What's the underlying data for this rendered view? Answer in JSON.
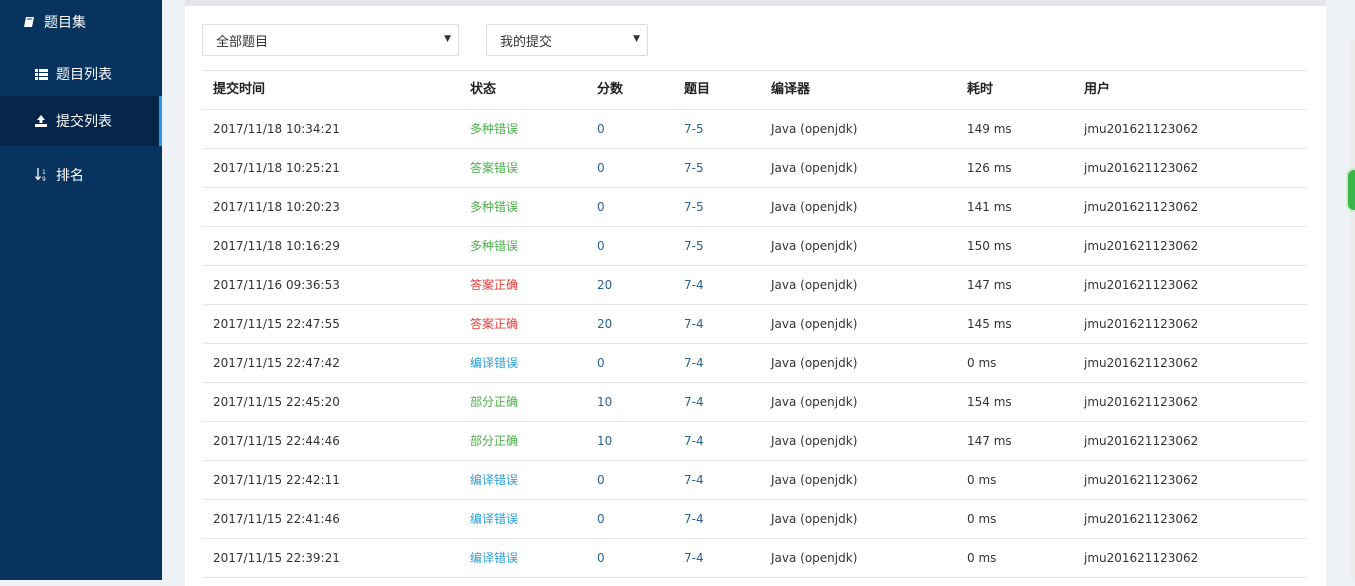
{
  "sidebar": {
    "items": [
      {
        "label": "题目集",
        "icon": "book-icon"
      },
      {
        "label": "题目列表",
        "icon": "list-icon"
      },
      {
        "label": "提交列表",
        "icon": "upload-icon",
        "active": true
      },
      {
        "label": "排名",
        "icon": "sort-icon"
      }
    ]
  },
  "filters": {
    "problem_filter": "全部题目",
    "submission_filter": "我的提交"
  },
  "table": {
    "headers": [
      "提交时间",
      "状态",
      "分数",
      "题目",
      "编译器",
      "耗时",
      "用户"
    ],
    "rows": [
      [
        "2017/11/18 10:34:21",
        "多种错误",
        "0",
        "7-5",
        "Java (openjdk)",
        "149 ms",
        "jmu201621123062"
      ],
      [
        "2017/11/18 10:25:21",
        "答案错误",
        "0",
        "7-5",
        "Java (openjdk)",
        "126 ms",
        "jmu201621123062"
      ],
      [
        "2017/11/18 10:20:23",
        "多种错误",
        "0",
        "7-5",
        "Java (openjdk)",
        "141 ms",
        "jmu201621123062"
      ],
      [
        "2017/11/18 10:16:29",
        "多种错误",
        "0",
        "7-5",
        "Java (openjdk)",
        "150 ms",
        "jmu201621123062"
      ],
      [
        "2017/11/16 09:36:53",
        "答案正确",
        "20",
        "7-4",
        "Java (openjdk)",
        "147 ms",
        "jmu201621123062"
      ],
      [
        "2017/11/15 22:47:55",
        "答案正确",
        "20",
        "7-4",
        "Java (openjdk)",
        "145 ms",
        "jmu201621123062"
      ],
      [
        "2017/11/15 22:47:42",
        "编译错误",
        "0",
        "7-4",
        "Java (openjdk)",
        "0 ms",
        "jmu201621123062"
      ],
      [
        "2017/11/15 22:45:20",
        "部分正确",
        "10",
        "7-4",
        "Java (openjdk)",
        "154 ms",
        "jmu201621123062"
      ],
      [
        "2017/11/15 22:44:46",
        "部分正确",
        "10",
        "7-4",
        "Java (openjdk)",
        "147 ms",
        "jmu201621123062"
      ],
      [
        "2017/11/15 22:42:11",
        "编译错误",
        "0",
        "7-4",
        "Java (openjdk)",
        "0 ms",
        "jmu201621123062"
      ],
      [
        "2017/11/15 22:41:46",
        "编译错误",
        "0",
        "7-4",
        "Java (openjdk)",
        "0 ms",
        "jmu201621123062"
      ],
      [
        "2017/11/15 22:39:21",
        "编译错误",
        "0",
        "7-4",
        "Java (openjdk)",
        "0 ms",
        "jmu201621123062"
      ]
    ]
  },
  "status_colors": {
    "多种错误": "#4cae4c",
    "答案错误": "#4cae4c",
    "答案正确": "#e5403a",
    "部分正确": "#4cae4c",
    "编译错误": "#2d9fd8"
  }
}
